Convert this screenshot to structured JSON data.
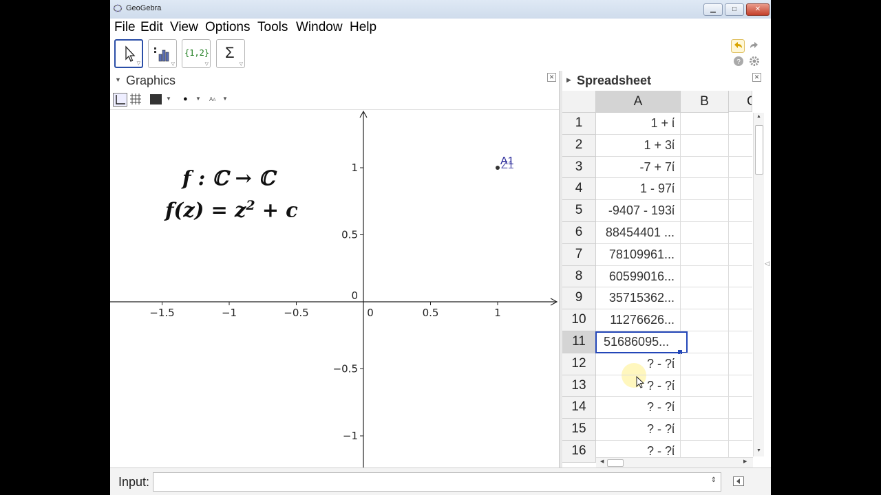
{
  "window": {
    "title": "GeoGebra"
  },
  "menu": [
    "File",
    "Edit",
    "View",
    "Options",
    "Tools",
    "Window",
    "Help"
  ],
  "toolbar": {
    "tools": [
      {
        "name": "move-tool",
        "icon": "arrow-pointer-icon"
      },
      {
        "name": "chart-tool",
        "icon": "bar-chart-icon"
      },
      {
        "name": "list-tool",
        "icon": "list-braces-icon",
        "label": "{1,2}"
      },
      {
        "name": "sum-tool",
        "icon": "sigma-icon",
        "label": "Σ"
      }
    ],
    "selected": 0
  },
  "graphics": {
    "title": "Graphics",
    "formula_line1": "f : ℂ → ℂ",
    "formula_line2_lhs": "f(z) = z",
    "formula_line2_exp": "2",
    "formula_line2_rhs": " + c",
    "x_ticks": [
      -1.5,
      -1,
      -0.5,
      0,
      0.5,
      1
    ],
    "x_tick_labels": [
      "−1.5",
      "−1",
      "−0.5",
      "0",
      "0.5",
      "1"
    ],
    "y_ticks": [
      -1,
      -0.5,
      0,
      0.5,
      1
    ],
    "y_tick_labels": [
      "−1",
      "−0.5",
      "0",
      "0.5",
      "1"
    ],
    "point": {
      "x": 1,
      "y": 1,
      "label": "A1",
      "label_overlap": "Z1"
    }
  },
  "spreadsheet": {
    "title": "Spreadsheet",
    "columns": [
      "A",
      "B",
      "C"
    ],
    "selected_row": 11,
    "rows": [
      {
        "n": "1",
        "a": "1 + ί"
      },
      {
        "n": "2",
        "a": "1 + 3ί"
      },
      {
        "n": "3",
        "a": "-7 + 7ί"
      },
      {
        "n": "4",
        "a": "1 - 97ί"
      },
      {
        "n": "5",
        "a": "-9407 - 193ί"
      },
      {
        "n": "6",
        "a": "88454401 ..."
      },
      {
        "n": "7",
        "a": "78109961..."
      },
      {
        "n": "8",
        "a": "60599016..."
      },
      {
        "n": "9",
        "a": "35715362..."
      },
      {
        "n": "10",
        "a": "11276626..."
      },
      {
        "n": "11",
        "a": "51686095..."
      },
      {
        "n": "12",
        "a": "? - ?ί"
      },
      {
        "n": "13",
        "a": "? - ?ί"
      },
      {
        "n": "14",
        "a": "? - ?ί"
      },
      {
        "n": "15",
        "a": "? - ?ί"
      },
      {
        "n": "16",
        "a": "? - ?ί"
      }
    ]
  },
  "input": {
    "label": "Input:",
    "value": ""
  },
  "colors": {
    "accent": "#2346b8",
    "point": "#2a2a9a",
    "cursor_halo": "#fff6b3"
  }
}
